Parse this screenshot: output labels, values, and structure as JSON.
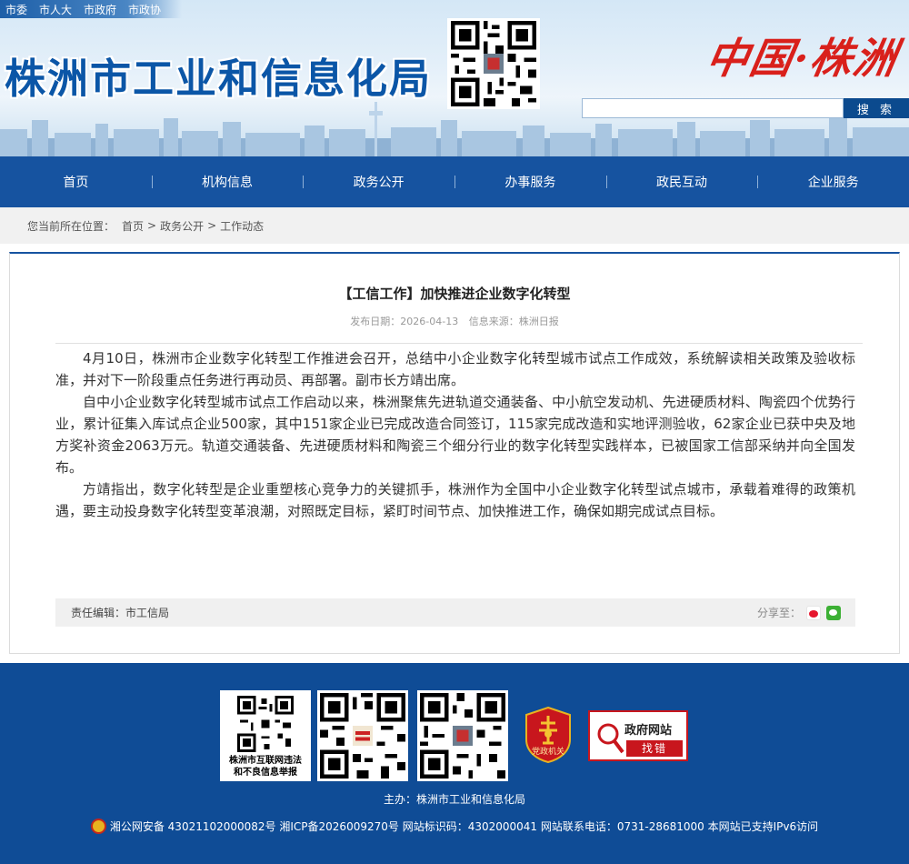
{
  "header": {
    "top_links": [
      "市委",
      "市人大",
      "市政府",
      "市政协"
    ],
    "site_title": "株洲市工业和信息化局",
    "slogan": "中国·株洲",
    "search": {
      "placeholder": "",
      "button_label": "搜 索"
    }
  },
  "nav": {
    "items": [
      "首页",
      "机构信息",
      "政务公开",
      "办事服务",
      "政民互动",
      "企业服务"
    ]
  },
  "breadcrumb": {
    "prefix": "您当前所在位置：",
    "items": [
      "首页",
      "政务公开",
      "工作动态"
    ],
    "separator": ">"
  },
  "article": {
    "title": "【工信工作】加快推进企业数字化转型",
    "date_label": "发布日期：2026-04-13",
    "source_label": "信息来源：株洲日报",
    "paragraphs": [
      "4月10日，株洲市企业数字化转型工作推进会召开，总结中小企业数字化转型城市试点工作成效，系统解读相关政策及验收标准，并对下一阶段重点任务进行再动员、再部署。副市长方靖出席。",
      "自中小企业数字化转型城市试点工作启动以来，株洲聚焦先进轨道交通装备、中小航空发动机、先进硬质材料、陶瓷四个优势行业，累计征集入库试点企业500家，其中151家企业已完成改造合同签订，115家完成改造和实地评测验收，62家企业已获中央及地方奖补资金2063万元。轨道交通装备、先进硬质材料和陶瓷三个细分行业的数字化转型实践样本，已被国家工信部采纳并向全国发布。",
      "方靖指出，数字化转型是企业重塑核心竞争力的关键抓手，株洲作为全国中小企业数字化转型试点城市，承载着难得的政策机遇，要主动投身数字化转型变革浪潮，对照既定目标，紧盯时间节点、加快推进工作，确保如期完成试点目标。"
    ],
    "editor_label": "责任编辑：市工信局",
    "share_label": "分享至："
  },
  "footer": {
    "qr_report_label_1": "株洲市互联网违法",
    "qr_report_label_2": "和不良信息举报",
    "party_badge_label": "党政机关",
    "gov_find_top": "政府网站",
    "gov_find_bottom": "找错",
    "host": "主办：株洲市工业和信息化局",
    "record": "湘公网安备 43021102000082号 湘ICP备2026009270号 网站标识码：4302000041 网站联系电话：0731-28681000 本网站已支持IPv6访问"
  },
  "colors": {
    "primary_blue": "#1653a0",
    "footer_blue": "#0f4c96",
    "accent_red": "#c8161d"
  }
}
